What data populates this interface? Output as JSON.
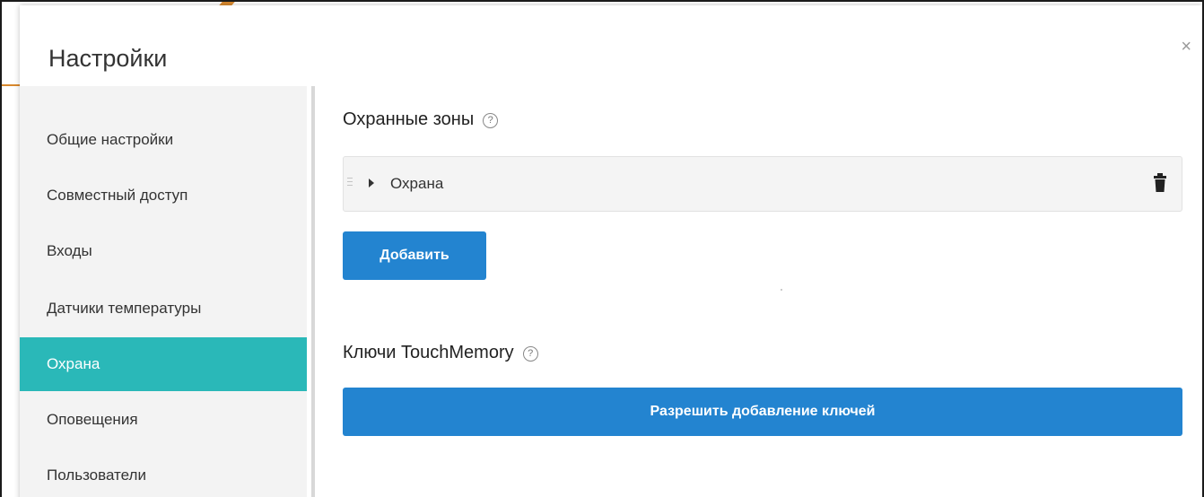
{
  "modal": {
    "title": "Настройки",
    "close_symbol": "×"
  },
  "sidebar": {
    "items": [
      {
        "label": "Общие настройки",
        "active": false
      },
      {
        "label": "Совместный доступ",
        "active": false
      },
      {
        "label": "Входы",
        "active": false
      },
      {
        "label": "Датчики температуры",
        "active": false
      },
      {
        "label": "Охрана",
        "active": true
      },
      {
        "label": "Оповещения",
        "active": false
      },
      {
        "label": "Пользователи",
        "active": false
      }
    ]
  },
  "zones_section": {
    "title": "Охранные зоны",
    "help_symbol": "?",
    "zones": [
      {
        "label": "Охрана"
      }
    ],
    "add_label": "Добавить"
  },
  "keys_section": {
    "title": "Ключи TouchMemory",
    "help_symbol": "?",
    "allow_label": "Разрешить добавление ключей"
  },
  "colors": {
    "accent_teal": "#2ab8b8",
    "button_blue": "#2384d0"
  },
  "icons": {
    "close": "close-icon",
    "help": "help-icon",
    "drag": "drag-handle-icon",
    "caret": "caret-right-icon",
    "trash": "trash-icon"
  }
}
